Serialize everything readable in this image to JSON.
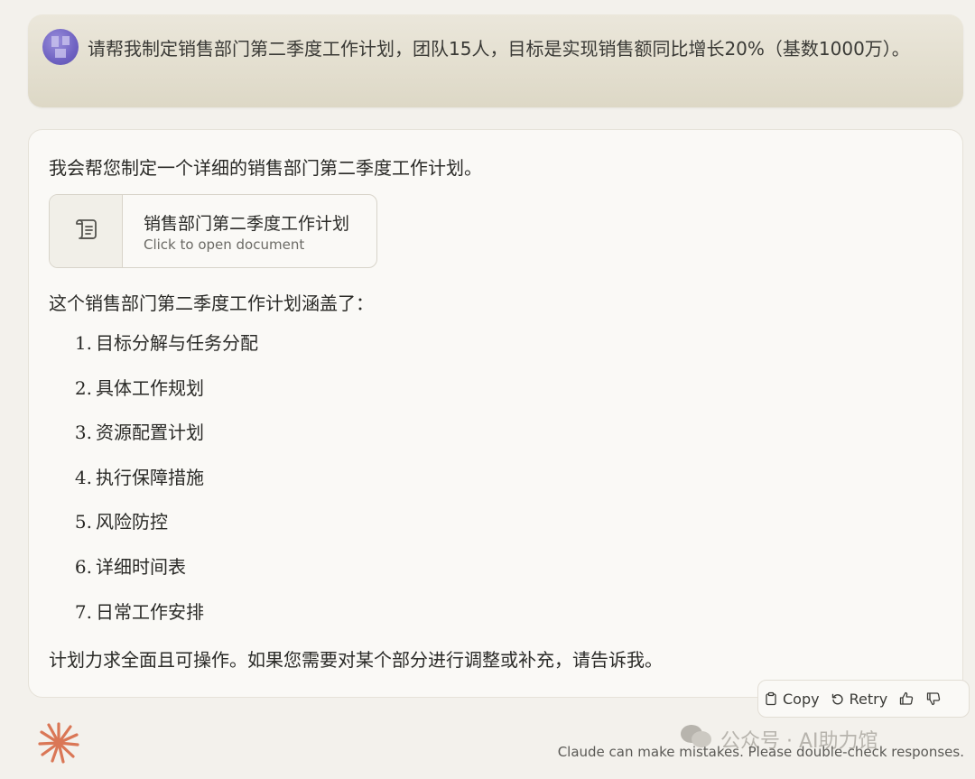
{
  "user_message": {
    "text": "请帮我制定销售部门第二季度工作计划，团队15人，目标是实现销售额同比增长20%（基数1000万）。"
  },
  "assistant_message": {
    "intro": "我会帮您制定一个详细的销售部门第二季度工作计划。",
    "artifact": {
      "title": "销售部门第二季度工作计划",
      "subtitle": "Click to open document",
      "icon": "scroll-document-icon"
    },
    "summary": "这个销售部门第二季度工作计划涵盖了：",
    "items": [
      {
        "num": "1.",
        "text": "目标分解与任务分配"
      },
      {
        "num": "2.",
        "text": "具体工作规划"
      },
      {
        "num": "3.",
        "text": "资源配置计划"
      },
      {
        "num": "4.",
        "text": "执行保障措施"
      },
      {
        "num": "5.",
        "text": "风险防控"
      },
      {
        "num": "6.",
        "text": "详细时间表"
      },
      {
        "num": "7.",
        "text": "日常工作安排"
      }
    ],
    "closing": "计划力求全面且可操作。如果您需要对某个部分进行调整或补充，请告诉我。"
  },
  "actions": {
    "copy": "Copy",
    "retry": "Retry",
    "icons": [
      "clipboard-icon",
      "retry-icon",
      "thumbs-up-icon",
      "thumbs-down-icon"
    ]
  },
  "footer": {
    "disclaimer": "Claude can make mistakes. Please double-check responses.",
    "watermark": "公众号 · AI助力馆"
  },
  "colors": {
    "accent": "#da7756",
    "background": "#f3f1ec",
    "user_bubble": "#e4e0d2"
  }
}
